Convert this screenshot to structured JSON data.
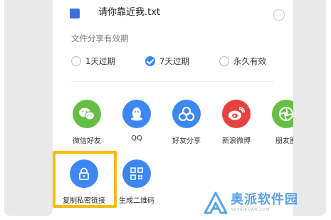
{
  "file": {
    "name": "请你靠近我.txt"
  },
  "expiry": {
    "title": "文件分享有效期",
    "options": [
      {
        "label": "1天过期",
        "selected": false
      },
      {
        "label": "7天过期",
        "selected": true
      },
      {
        "label": "永久有效",
        "selected": false
      }
    ]
  },
  "share_targets": [
    {
      "label": "微信好友",
      "icon": "wechat-icon",
      "color": "#66bf44"
    },
    {
      "label": "QQ",
      "icon": "qq-penguin-icon",
      "color": "#3d87f5"
    },
    {
      "label": "好友分享",
      "icon": "friends-share-icon",
      "color": "#3d87f5"
    },
    {
      "label": "新浪微博",
      "icon": "weibo-icon",
      "color": "#e64340"
    },
    {
      "label": "朋友圈",
      "icon": "moments-icon",
      "color": "#66bf44"
    }
  ],
  "link_actions": [
    {
      "label": "复制私密链接",
      "icon": "lock-icon",
      "color": "#3d87f5"
    },
    {
      "label": "生成二维码",
      "icon": "qrcode-icon",
      "color": "#3d87f5"
    }
  ],
  "watermark": {
    "title": "奥派软件园",
    "subtitle": "AOPAIRUAN.COM"
  },
  "colors": {
    "accent": "#3d87f5",
    "highlight": "#f4bd16"
  }
}
